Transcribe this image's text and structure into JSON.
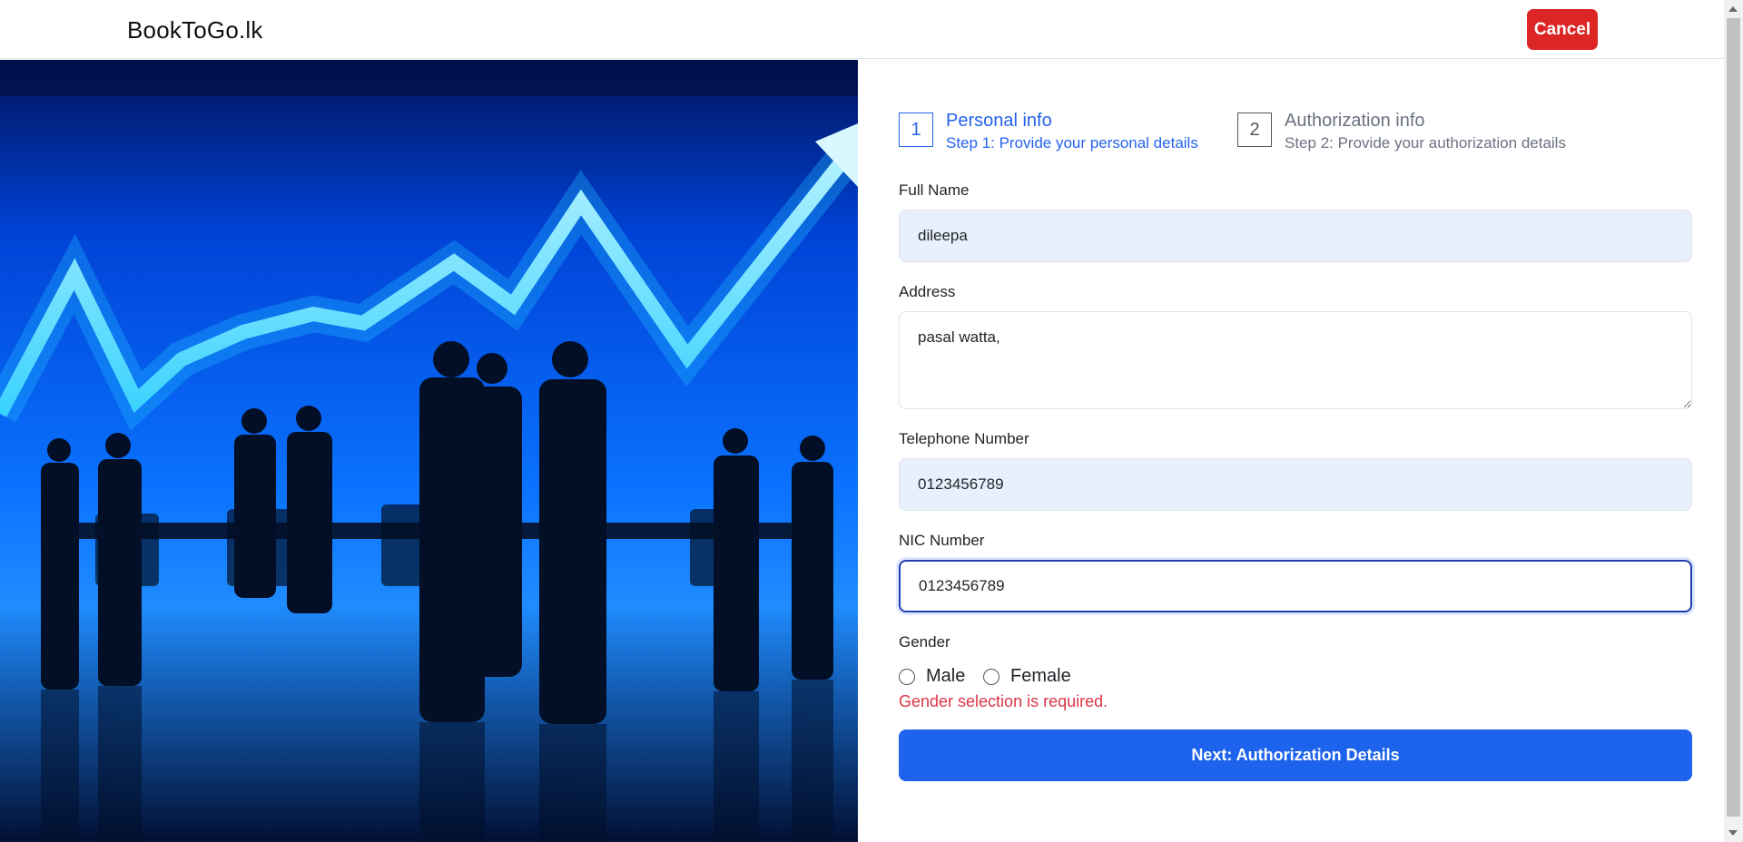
{
  "header": {
    "brand": "BookToGo.lk",
    "cancel_label": "Cancel",
    "cancel_color": "#dc2626"
  },
  "steps": [
    {
      "number": "1",
      "title": "Personal info",
      "subtitle": "Step 1: Provide your personal details",
      "active": true
    },
    {
      "number": "2",
      "title": "Authorization info",
      "subtitle": "Step 2: Provide your authorization details",
      "active": false
    }
  ],
  "form": {
    "full_name": {
      "label": "Full Name",
      "value": "dileepa"
    },
    "address": {
      "label": "Address",
      "value": "pasal watta,"
    },
    "telephone": {
      "label": "Telephone Number",
      "value": "0123456789"
    },
    "nic": {
      "label": "NIC Number",
      "value": "0123456789"
    },
    "gender": {
      "label": "Gender",
      "options": [
        "Male",
        "Female"
      ],
      "selected": null,
      "error": "Gender selection is required."
    },
    "submit_label": "Next: Authorization Details"
  },
  "colors": {
    "accent": "#2563eb",
    "button": "#1d63ed",
    "error": "#dc3545"
  },
  "hero_image": {
    "icon": "business-meeting-growth-chart-image"
  }
}
